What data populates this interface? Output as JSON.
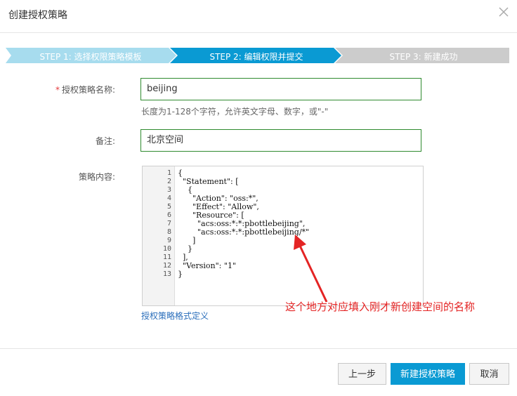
{
  "dialog": {
    "title": "创建授权策略"
  },
  "steps": [
    {
      "label": "STEP 1:  选择权限策略模板",
      "state": "done"
    },
    {
      "label": "STEP 2:  编辑权限并提交",
      "state": "active"
    },
    {
      "label": "STEP 3:  新建成功",
      "state": "pending"
    }
  ],
  "form": {
    "name_label": "授权策略名称:",
    "name_required_mark": "*",
    "name_value": "beijing",
    "name_hint": "长度为1-128个字符，允许英文字母、数字，或\"-\"",
    "note_label": "备注:",
    "note_value": "北京空间",
    "content_label": "策略内容:"
  },
  "editor": {
    "line_numbers": [
      "1",
      "2",
      "3",
      "4",
      "5",
      "6",
      "7",
      "8",
      "9",
      "10",
      "11",
      "12",
      "13"
    ],
    "lines": [
      "{",
      "  \"Statement\": [",
      "    {",
      "      \"Action\": \"oss:*\",",
      "      \"Effect\": \"Allow\",",
      "      \"Resource\": [",
      "        \"acs:oss:*:*:pbottlebeijing\",",
      "        \"acs:oss:*:*:pbottlebeijing/*\"",
      "      ]",
      "    }",
      "  ],",
      "  \"Version\": \"1\"",
      "}"
    ]
  },
  "links": {
    "policy_format": "授权策略格式定义"
  },
  "annotation": {
    "text": "这个地方对应填入刚才新创建空间的名称"
  },
  "buttons": {
    "prev": "上一步",
    "create": "新建授权策略",
    "cancel": "取消"
  },
  "colors": {
    "step_done": "#a7dcee",
    "step_active": "#0a9ad3",
    "step_pending": "#cccccc",
    "input_border": "#2f8b2f",
    "annotation": "#e42424",
    "link": "#2a6ebb"
  }
}
